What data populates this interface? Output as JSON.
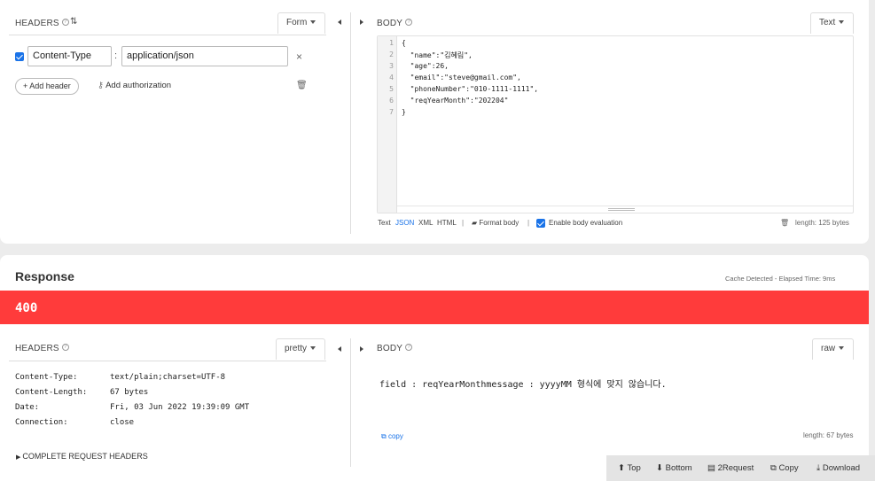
{
  "request": {
    "headers_label": "HEADERS",
    "form_dropdown": "Form",
    "header_row": {
      "name": "Content-Type",
      "separator": ":",
      "value": "application/json"
    },
    "add_header": "+ Add header",
    "add_authorization": "Add authorization",
    "body_label": "BODY",
    "text_dropdown": "Text",
    "line_numbers": [
      "1",
      "2",
      "3",
      "4",
      "5",
      "6",
      "7"
    ],
    "code_lines": [
      "{",
      "  \"name\":\"김혜림\",",
      "  \"age\":26,",
      "  \"email\":\"steve@gmail.com\",",
      "  \"phoneNumber\":\"010-1111-1111\",",
      "  \"reqYearMonth\":\"202204\"",
      "}"
    ],
    "footer": {
      "text": "Text",
      "json": "JSON",
      "xml": "XML",
      "html": "HTML",
      "sep": "|",
      "format_body": "Format body",
      "enable_eval": "Enable body evaluation",
      "length": "length: 125 bytes"
    }
  },
  "response": {
    "title": "Response",
    "cache": "Cache Detected - Elapsed Time: 9ms",
    "status": "400",
    "status_color": "#ff3b3b",
    "headers_label": "HEADERS",
    "pretty_dropdown": "pretty",
    "headers": [
      {
        "key": "Content-Type:",
        "value": "text/plain;charset=UTF-8"
      },
      {
        "key": "Content-Length:",
        "value": "67 bytes"
      },
      {
        "key": "Date:",
        "value": "Fri, 03 Jun 2022 19:39:09 GMT"
      },
      {
        "key": "Connection:",
        "value": "close"
      }
    ],
    "complete_headers": "COMPLETE REQUEST HEADERS",
    "body_label": "BODY",
    "raw_dropdown": "raw",
    "body_text": "field : reqYearMonthmessage : yyyyMM 형식에 맞지 않습니다.",
    "copy": "copy",
    "length": "length: 67 bytes"
  },
  "toolbar": {
    "top": "Top",
    "bottom": "Bottom",
    "request2": "2Request",
    "copy": "Copy",
    "download": "Download"
  }
}
